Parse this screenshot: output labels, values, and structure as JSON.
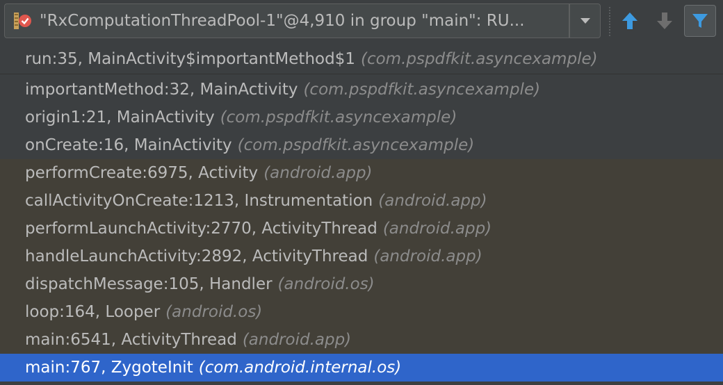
{
  "thread_selector": {
    "label": "\"RxComputationThreadPool-1\"@4,910 in group \"main\": RU...",
    "icon": "thread-suspended-icon"
  },
  "toolbar": {
    "dropdown_icon": "chevron-down-icon",
    "up_icon": "arrow-up-icon",
    "down_icon": "arrow-down-icon",
    "filter_icon": "filter-icon"
  },
  "frames": [
    {
      "frame": "run:35, MainActivity$importantMethod$1",
      "pkg": "(com.pspdfkit.asyncexample)",
      "kind": "app"
    },
    {
      "frame": "importantMethod:32, MainActivity",
      "pkg": "(com.pspdfkit.asyncexample)",
      "kind": "app"
    },
    {
      "frame": "origin1:21, MainActivity",
      "pkg": "(com.pspdfkit.asyncexample)",
      "kind": "app"
    },
    {
      "frame": "onCreate:16, MainActivity",
      "pkg": "(com.pspdfkit.asyncexample)",
      "kind": "app"
    },
    {
      "frame": "performCreate:6975, Activity",
      "pkg": "(android.app)",
      "kind": "lib"
    },
    {
      "frame": "callActivityOnCreate:1213, Instrumentation",
      "pkg": "(android.app)",
      "kind": "lib"
    },
    {
      "frame": "performLaunchActivity:2770, ActivityThread",
      "pkg": "(android.app)",
      "kind": "lib"
    },
    {
      "frame": "handleLaunchActivity:2892, ActivityThread",
      "pkg": "(android.app)",
      "kind": "lib"
    },
    {
      "frame": "dispatchMessage:105, Handler",
      "pkg": "(android.os)",
      "kind": "lib"
    },
    {
      "frame": "loop:164, Looper",
      "pkg": "(android.os)",
      "kind": "lib"
    },
    {
      "frame": "main:6541, ActivityThread",
      "pkg": "(android.app)",
      "kind": "lib"
    },
    {
      "frame": "main:767, ZygoteInit",
      "pkg": "(com.android.internal.os)",
      "kind": "selected"
    }
  ],
  "colors": {
    "background": "#3c3f41",
    "library_frame_bg": "#434038",
    "selection": "#2f65ca",
    "accent_blue": "#3d9ae0"
  }
}
